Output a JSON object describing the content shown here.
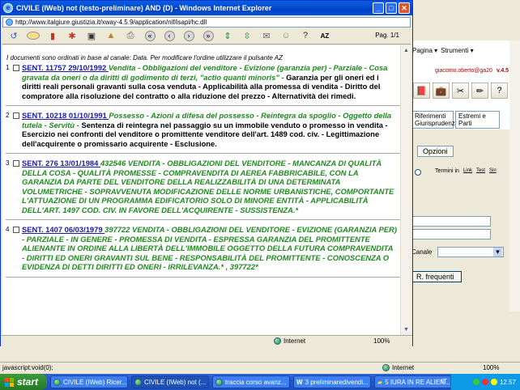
{
  "background_window": {
    "toolbar_items": [
      "Pagina ▾",
      "Strumenti ▾"
    ],
    "user": "giacomo.oberto@ga20",
    "version": "v.4.5",
    "tabs": [
      "Riferimenti Giurisprudenziali",
      "Estremi e Parti"
    ],
    "options_button": "Opzioni",
    "termini_label": "Termini in",
    "termini_options": [
      "Link",
      "Test",
      "Sin"
    ],
    "canale_label": "Canale",
    "rfrequenti_button": "R. frequenti",
    "status_left": "javascript:void(0);",
    "zone": "Internet",
    "zoom": "100%"
  },
  "popup": {
    "title": "CIVILE (IWeb) not (testo-preliminare) AND (D) - Windows Internet Explorer",
    "url": "http://www.italgiure.giustizia.it/xway-4.5.9/application/nif/isapi/hc.dll",
    "page_info": "Pag. 1/1",
    "note": "I documenti sono ordinati in base al canale: Data. Per modificare l'ordine utilizzare il pulsante AZ",
    "toolbar_icons": [
      "undo-icon",
      "oval-icon",
      "book-icon",
      "puzzle-icon",
      "save-icon",
      "bag-icon",
      "print-icon",
      "first-icon",
      "prev-icon",
      "next-icon",
      "last-icon",
      "expand-icon",
      "collapse-icon",
      "mail-icon",
      "people-icon",
      "help-icon",
      "az-sort-icon"
    ],
    "documents": [
      {
        "num": "1",
        "sent": "SENT. 11757 29/10/1992",
        "green": "Vendita - Obbligazioni del venditore - Evizione (garanzia per) - Parziale - Cosa gravata da oneri o da diritti di godimento di terzi, \"actio quanti minoris\" -",
        "black": "Garanzia per gli oneri ed i diritti reali personali gravanti sulla cosa venduta - Applicabilità alla promessa di vendita - Diritto del compratore alla risoluzione del contratto o alla riduzione del prezzo - Alternatività dei rimedi."
      },
      {
        "num": "2",
        "sent": "SENT. 10218 01/10/1991",
        "green": "Possesso - Azioni a difesa del possesso - Reintegra da spoglio - Oggetto della tutela - Servitù -",
        "black": "Sentenza di reintegra nel passaggio su un immobile venduto o promesso in vendita - Esercizio nei confronti del venditore o promittente venditore dell'art. 1489 cod. civ. - Legittimazione dell'acquirente o promissario acquirente - Esclusione."
      },
      {
        "num": "3",
        "sent": "SENT. 276 13/01/1984",
        "green": "432546 VENDITA - OBBLIGAZIONI DEL VENDITORE - MANCANZA DI QUALITÀ DELLA COSA - QUALITÀ PROMESSE - COMPRAVENDITA DI AEREA FABBRICABILE, CON LA GARANZIA DA PARTE DEL VENDITORE DELLA REALIZZABILITÀ DI UNA DETERMINATA VOLUMETRICHE - SOPRAVVENUTA MODIFICAZIONE DELLE NORME URBANISTICHE, COMPORTANTE L'ATTUAZIONE DI UN PROGRAMMA EDIFICATORIO SOLO DI MINORE ENTITÀ - APPLICABILITÀ DELL'ART. 1497 COD. CIV. IN FAVORE DELL'ACQUIRENTE - SUSSISTENZA.*",
        "black": ""
      },
      {
        "num": "4",
        "sent": "SENT. 1407 06/03/1979",
        "green": "397722 VENDITA - OBBLIGAZIONI DEL VENDITORE - EVIZIONE (GARANZIA PER) - PARZIALE - IN GENERE - PROMESSA DI VENDITA - ESPRESSA GARANZIA DEL PROMITTENTE ALIENANTE IN ORDINE ALLA LIBERTÀ DELL'IMMOBILE OGGETTO DELLA FUTURA COMPRAVENDITA - DIRITTI ED ONERI GRAVANTI SUL BENE - RESPONSABILITÀ DEL PROMITTENTE - CONOSCENZA O EVIDENZA DI DETTI DIRITTI ED ONERI - IRRILEVANZA.* , 397722*",
        "black": ""
      }
    ],
    "status_zone": "Internet",
    "status_zoom": "100%"
  },
  "taskbar": {
    "start": "start",
    "tasks": [
      "CIVILE (IWeb) Ricer...",
      "CIVILE (IWeb) not (...",
      "traccia corso avanz...",
      "3 preliminaredivendi...",
      "5 IURA IN RE ALIEN..."
    ],
    "lang": "IT",
    "clock": "12.57"
  }
}
